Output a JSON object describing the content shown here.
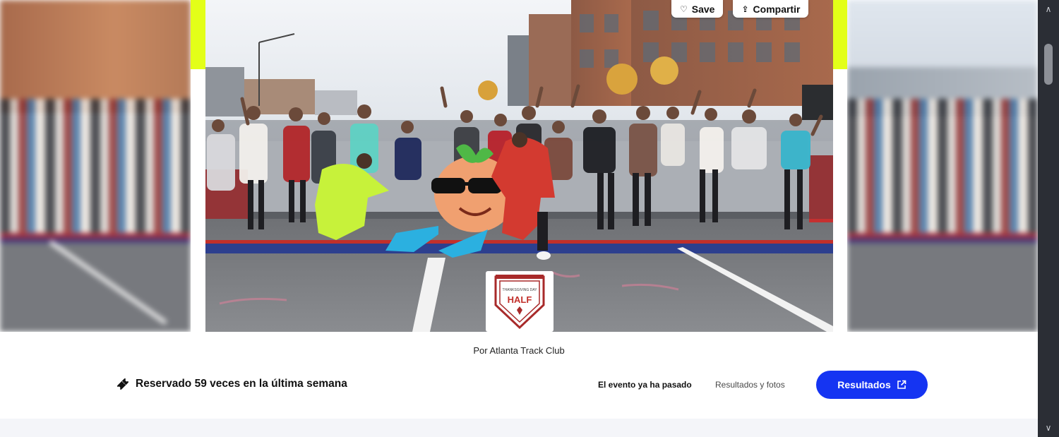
{
  "hero": {
    "actions": {
      "save_label": "Save",
      "save_icon": "heart-icon",
      "share_label": "Compartir",
      "share_icon": "share-icon"
    },
    "accent_color": "#e3ff18",
    "badge": {
      "label": "HALF",
      "icon": "event-logo-badge"
    }
  },
  "organizer": {
    "text": "Por Atlanta Track Club"
  },
  "booking": {
    "icon": "ticket-icon",
    "text": "Reservado 59 veces en la última semana"
  },
  "event": {
    "status": "El evento ya ha pasado",
    "results_photos_link": "Resultados y fotos",
    "results_button": "Resultados",
    "results_button_icon": "external-link-icon",
    "button_color": "#1534f2"
  },
  "scrollbar": {
    "up_icon": "scroll-up-arrow-icon",
    "down_icon": "scroll-down-arrow-icon"
  }
}
